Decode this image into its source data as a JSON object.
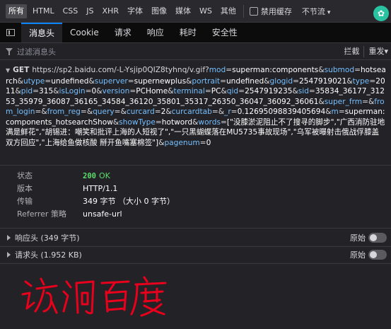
{
  "filter_types": [
    "所有",
    "HTML",
    "CSS",
    "JS",
    "XHR",
    "字体",
    "图像",
    "媒体",
    "WS",
    "其他"
  ],
  "toolbar": {
    "disable_cache": "禁用缓存",
    "throttle": "不节流",
    "throttle_caret": "▾",
    "tools_icon": "✿"
  },
  "tabs": [
    "消息头",
    "Cookie",
    "请求",
    "响应",
    "耗时",
    "安全性"
  ],
  "search": {
    "placeholder": "过滤消息头",
    "block": "拦截",
    "resend": "重发",
    "resend_caret": "▾"
  },
  "request": {
    "toggle": "▼",
    "method": "GET",
    "base_url": "https://sp2.baidu.com/-L-Ysjip0QIZ8tyhnq/v.gif?",
    "params": [
      {
        "k": "mod",
        "v": "superman:components"
      },
      {
        "k": "submod",
        "v": "hotsearch"
      },
      {
        "k": "utype",
        "v": "undefined"
      },
      {
        "k": "superver",
        "v": "supernewplus"
      },
      {
        "k": "portrait",
        "v": "undefined"
      },
      {
        "k": "glogid",
        "v": "2547919021"
      },
      {
        "k": "type",
        "v": "2011"
      },
      {
        "k": "pid",
        "v": "315"
      },
      {
        "k": "isLogin",
        "v": "0"
      },
      {
        "k": "version",
        "v": "PCHome"
      },
      {
        "k": "terminal",
        "v": "PC"
      },
      {
        "k": "qid",
        "v": "2547919235"
      },
      {
        "k": "sid",
        "v": "35834_36177_31253_35979_36087_36165_34584_36120_35801_35317_26350_36047_36092_36061"
      },
      {
        "k": "super_frm",
        "v": ""
      },
      {
        "k": "from_login",
        "v": ""
      },
      {
        "k": "from_reg",
        "v": ""
      },
      {
        "k": "query",
        "v": ""
      },
      {
        "k": "curcard",
        "v": "2"
      },
      {
        "k": "curcardtab",
        "v": ""
      },
      {
        "k": "_r",
        "v": "0.12695098839405694"
      },
      {
        "k": "m",
        "v": "superman:components_hotsearchShow"
      },
      {
        "k": "showType",
        "v": "hotword"
      },
      {
        "k": "words",
        "v": "[\"没膝淤泥阻止不了搜寻的脚步\",\"广西消防驻地满是鲜花\",\"胡锡进：嘲笑和批评上海的人短视了\",\"一只黑蝴蝶落在MU5735事故现场\",\"乌军被曝射击俄战俘膝盖 双方回应\",\"上海给鱼做核酸 掰开鱼嘴塞棉签\"]"
      },
      {
        "k": "pagenum",
        "v": "0"
      }
    ]
  },
  "info": {
    "status_label": "状态",
    "status_code": "200",
    "status_text": "OK",
    "version_label": "版本",
    "version_value": "HTTP/1.1",
    "transfer_label": "传输",
    "transfer_value": "349 字节 （大小 0 字节）",
    "referrer_label": "Referrer 策略",
    "referrer_value": "unsafe-url"
  },
  "sections": {
    "response_headers": "响应头 (349 字节)",
    "request_headers": "请求头 (1.952 KB)",
    "raw_label": "原始"
  },
  "annotation": "访问百度",
  "colors": {
    "accent": "#0a84ff",
    "status_ok": "#5bdc6a",
    "param_key": "#75bfff",
    "annotation_ink": "#e8001c"
  }
}
